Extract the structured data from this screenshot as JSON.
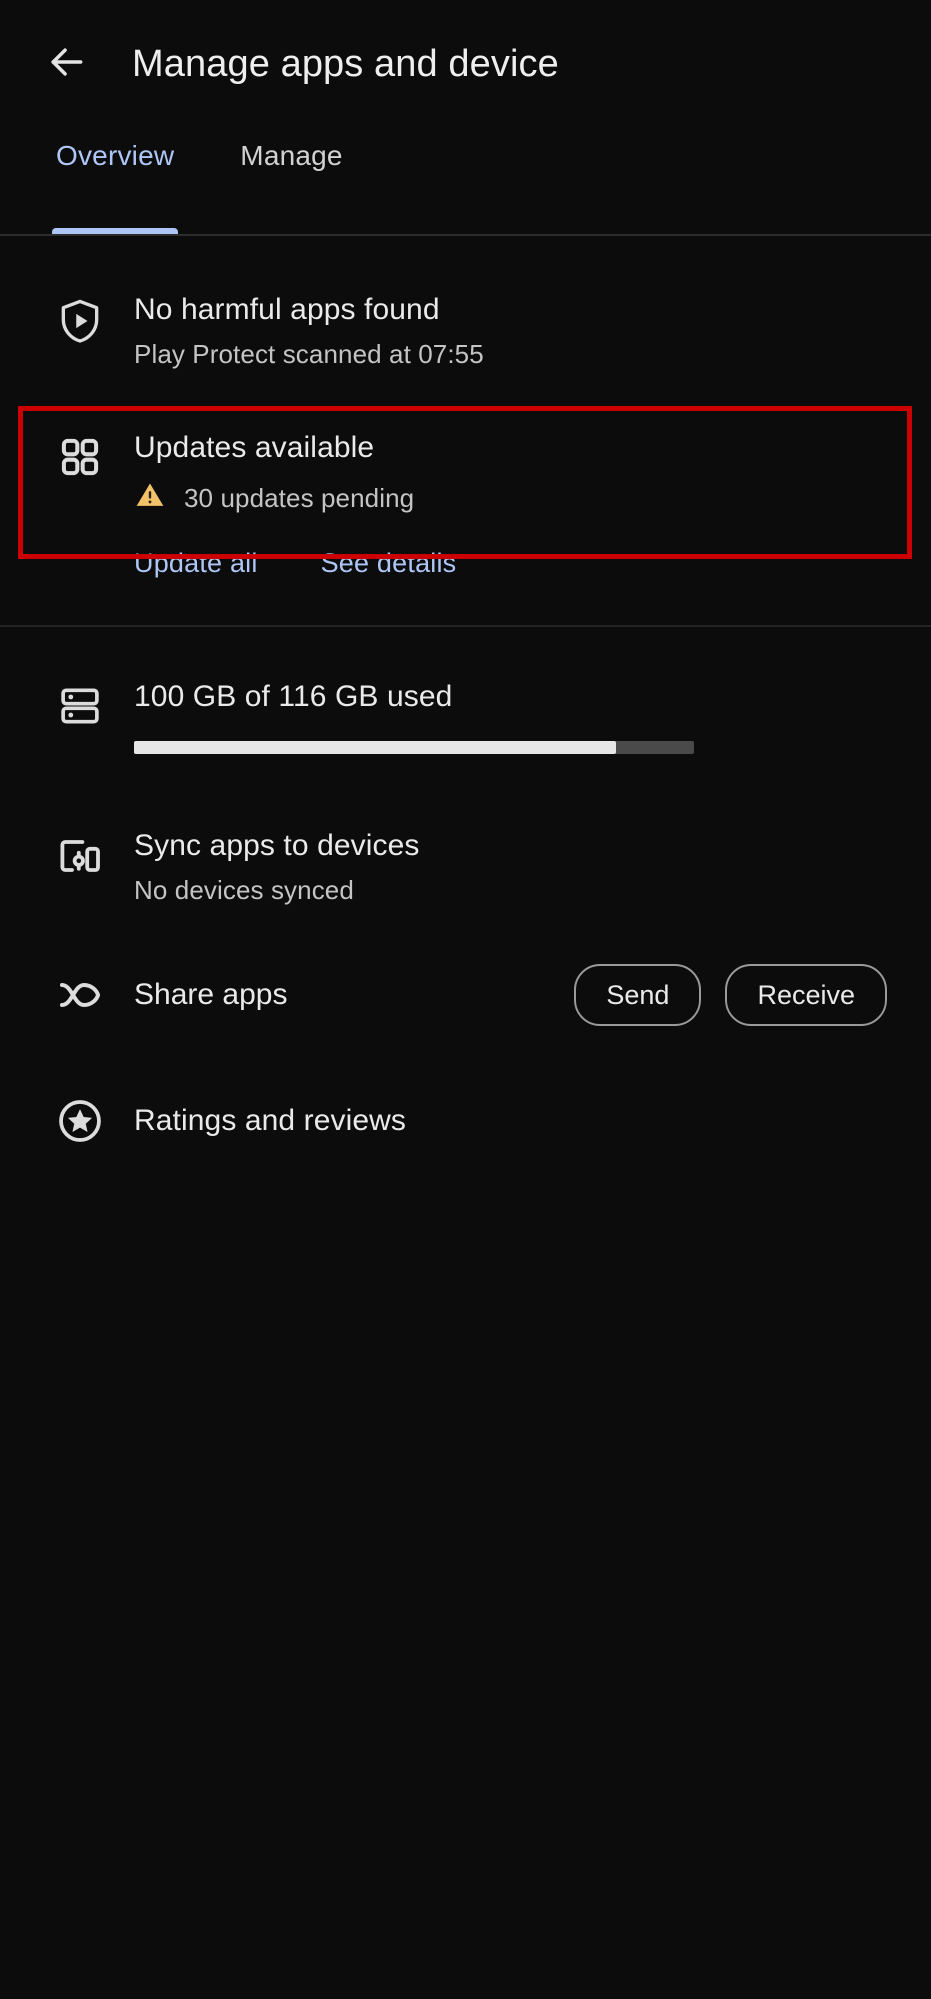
{
  "appbar": {
    "back_icon": "arrow-left-icon",
    "title": "Manage apps and device"
  },
  "tabs": [
    {
      "label": "Overview",
      "active": true
    },
    {
      "label": "Manage",
      "active": false
    }
  ],
  "sections": {
    "play_protect": {
      "icon": "shield-play-icon",
      "title": "No harmful apps found",
      "subtitle": "Play Protect scanned at 07:55"
    },
    "updates": {
      "icon": "apps-grid-icon",
      "title": "Updates available",
      "warning_icon": "warning-triangle-icon",
      "subtitle": "30 updates pending",
      "links": [
        {
          "label": "Update all"
        },
        {
          "label": "See details"
        }
      ],
      "highlight_color": "#cc0000"
    },
    "storage": {
      "icon": "storage-icon",
      "title": "100 GB of 116 GB used",
      "progress_percent": 86
    },
    "sync": {
      "icon": "devices-icon",
      "title": "Sync apps to devices",
      "subtitle": "No devices synced"
    },
    "share": {
      "icon": "share-apps-icon",
      "title": "Share apps",
      "buttons": [
        {
          "label": "Send"
        },
        {
          "label": "Receive"
        }
      ]
    },
    "ratings": {
      "icon": "star-circle-icon",
      "title": "Ratings and reviews"
    }
  },
  "colors": {
    "background": "#0c0c0c",
    "accent_blue": "#aec6f5",
    "warning_amber": "#f3c169",
    "highlight_red": "#cc0000"
  }
}
